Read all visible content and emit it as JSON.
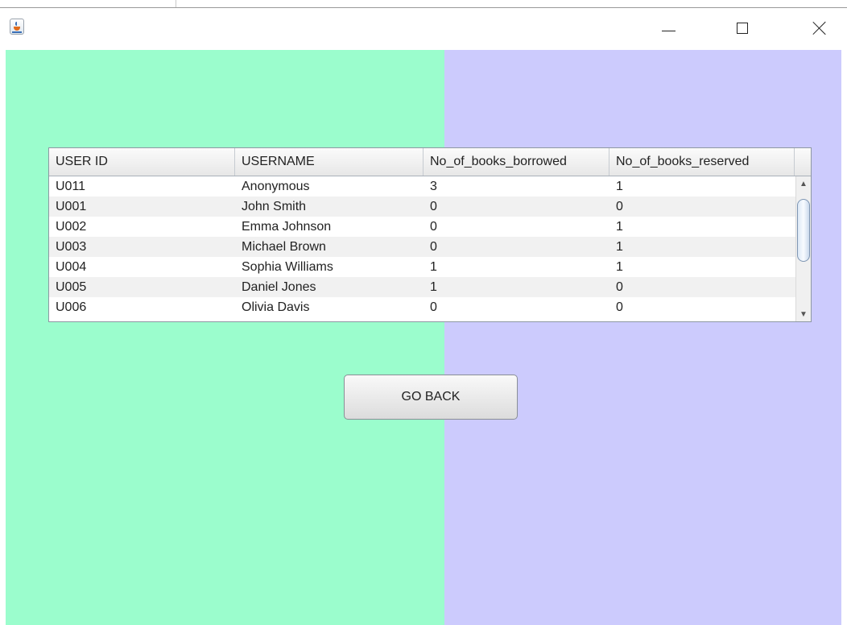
{
  "window": {
    "icon": "java-cup-icon",
    "controls": [
      "minimize-icon",
      "maximize-icon",
      "close-icon"
    ]
  },
  "colors": {
    "left_panel": "#9bfdcd",
    "right_panel": "#cccbfd"
  },
  "table": {
    "headers": [
      "USER ID",
      "USERNAME",
      "No_of_books_borrowed",
      "No_of_books_reserved"
    ],
    "rows": [
      [
        "U011",
        "Anonymous",
        "3",
        "1"
      ],
      [
        "U001",
        "John Smith",
        "0",
        "0"
      ],
      [
        "U002",
        "Emma Johnson",
        "0",
        "1"
      ],
      [
        "U003",
        "Michael Brown",
        "0",
        "1"
      ],
      [
        "U004",
        "Sophia Williams",
        "1",
        "1"
      ],
      [
        "U005",
        "Daniel Jones",
        "1",
        "0"
      ],
      [
        "U006",
        "Olivia Davis",
        "0",
        "0"
      ]
    ]
  },
  "buttons": {
    "go_back": "GO BACK"
  }
}
